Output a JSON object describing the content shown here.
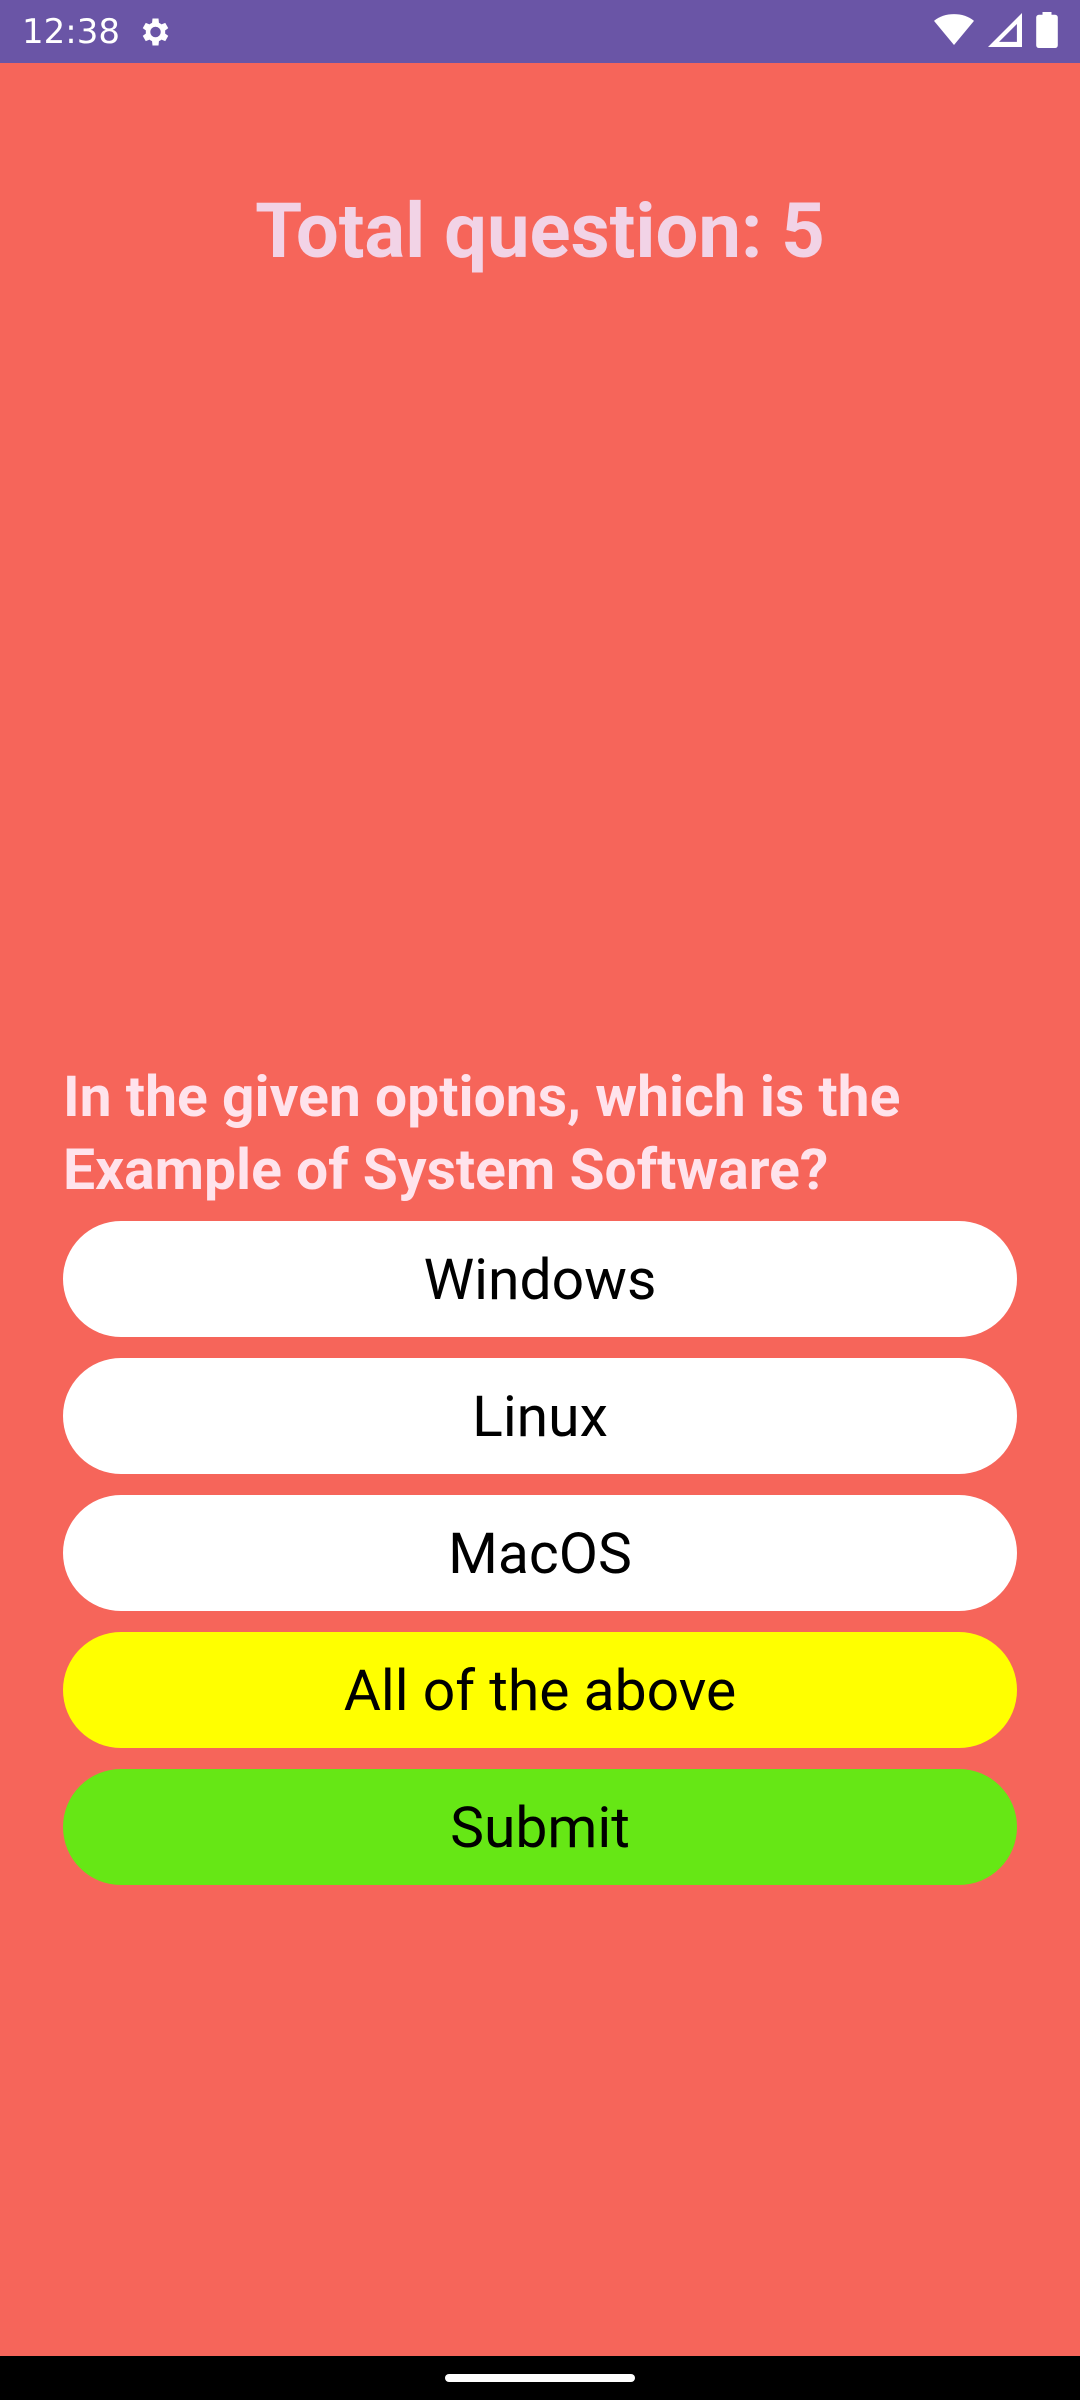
{
  "status_bar": {
    "time": "12:38",
    "icons": [
      "gear-icon",
      "wifi-icon",
      "signal-icon",
      "battery-icon"
    ]
  },
  "quiz": {
    "total_label": "Total question: 5",
    "question": "In the given options, which is the Example of System Software?",
    "options": [
      {
        "label": "Windows"
      },
      {
        "label": "Linux"
      },
      {
        "label": "MacOS"
      },
      {
        "label": "All of the above",
        "selected": true
      }
    ],
    "submit_label": "Submit"
  },
  "colors": {
    "background": "#F6655A",
    "status_bar": "#6A55A6",
    "option_default": "#FFFFFF",
    "option_selected": "#FFFF00",
    "submit": "#66E715"
  }
}
